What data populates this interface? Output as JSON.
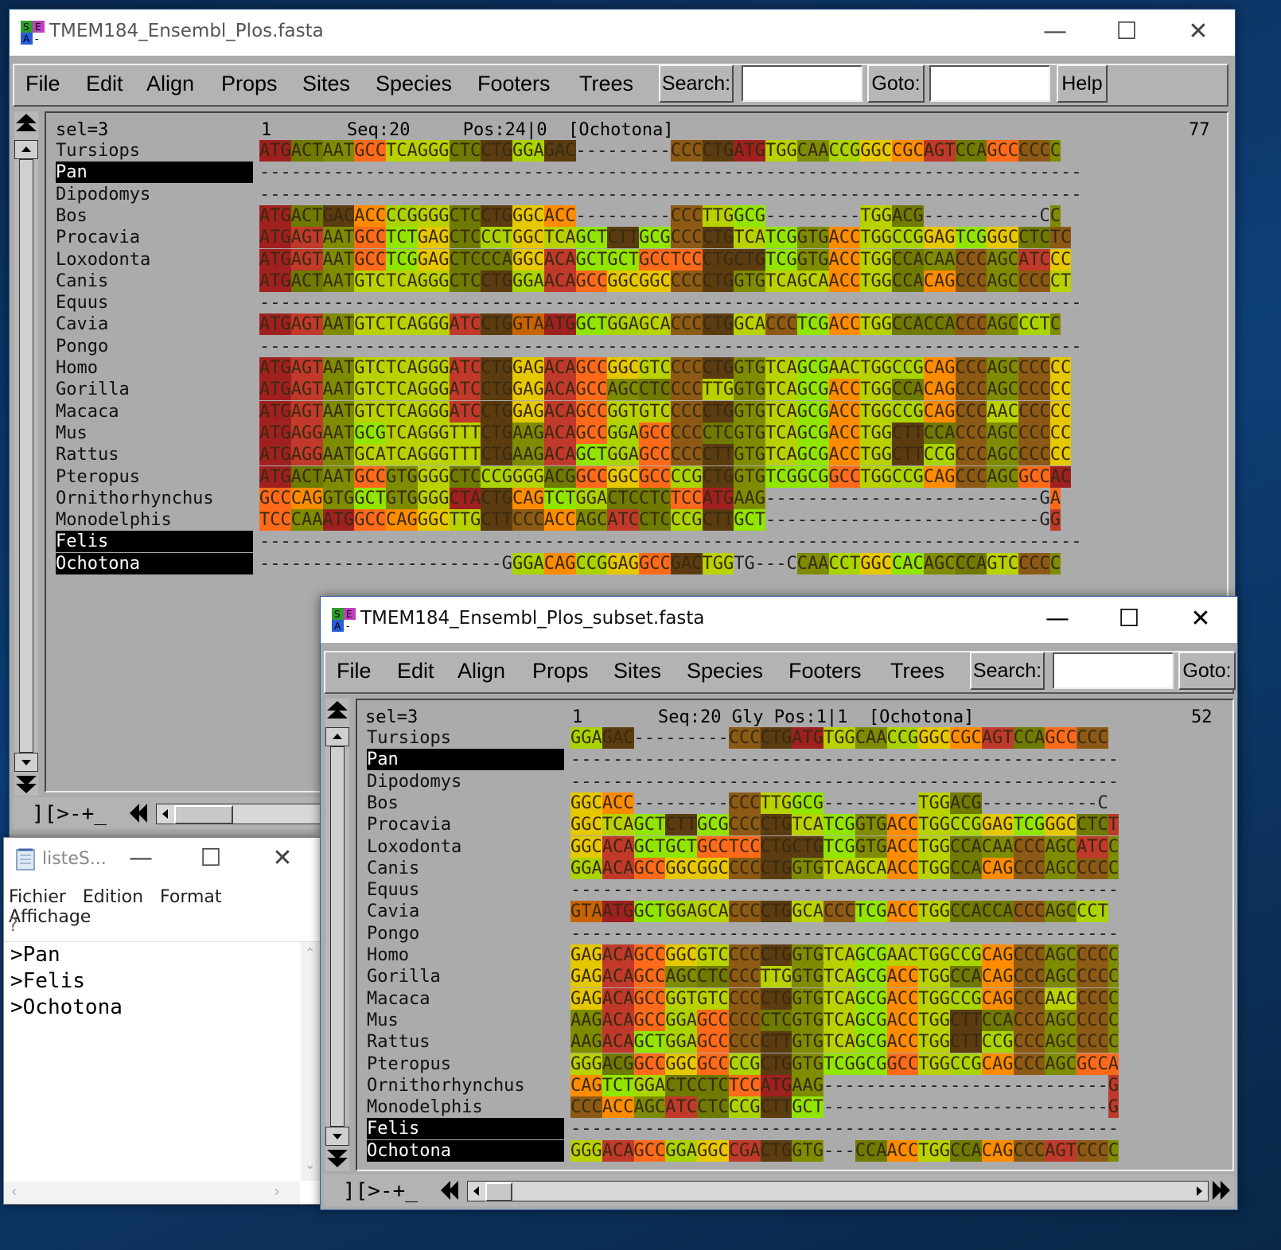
{
  "colors": {
    "A": "#ff6a1a",
    "B": "#8c5a14",
    "C": "#7d8c00",
    "D": "#5a3c10",
    "E": "#91e600",
    "F": "#aad400",
    "G": "#c0392b",
    "H": "#e6c800",
    "I": "#ff8c00",
    "J": "#c86400"
  },
  "main": {
    "title": "TMEM184_Ensembl_Plos.fasta",
    "menu": [
      "File",
      "Edit",
      "Align",
      "Props",
      "Sites",
      "Species",
      "Footers",
      "Trees"
    ],
    "search_label": "Search:",
    "goto_label": "Goto:",
    "help_label": "Help",
    "header": {
      "sel": "sel=3",
      "pos_start": "1",
      "info": "Seq:20     Pos:24|0  [Ochotona]",
      "pos_end": "77"
    },
    "bottom_label": "][>-+_",
    "names": [
      "Tursiops",
      "Pan",
      "Dipodomys",
      "Bos",
      "Procavia",
      "Loxodonta",
      "Canis",
      "Equus",
      "Cavia",
      "Pongo",
      "Homo",
      "Gorilla",
      "Macaca",
      "Mus",
      "Rattus",
      "Pteropus",
      "Ornithorhynchus",
      "Monodelphis",
      "Felis",
      "Ochotona"
    ],
    "selected": [
      1,
      18,
      19
    ],
    "seqs": [
      "ATGACTAATGCCTCAGGGCTCCTGGGAGAC---------CCCCTGATGTGGCAACCGGGCCGCAGTCCAGCCCCCC",
      "------------------------------------------------------------------------------",
      "------------------------------------------------------------------------------",
      "ATGACTGACACCCCGGGGCTCCTGGGCACC---------CCCTTGGCG---------TGGACG-----------CC",
      "ATGAGTAATGCCTCTGAGCTCCCTGGCTCAGCTCTTGCGCCCCTGTCATCGGTGACCTGGCCGGAGTCGGGCCTCTC",
      "ATGAGTAATGCCTCGGAGCTCCCAGGCACAGCTGCTGCCTCCCTGCTGTCGGTGACCTGGCCACAACCCAGCATCCC",
      "ATGACTAATGTCTCAGGGCTCCTGGGAACAGCCGGCGGCCCCCTGGTGTCAGCAACCTGGCCACAGCCCAGCCCCCT",
      "------------------------------------------------------------------------------",
      "ATGAGTAATGTCTCAGGGATCCTGGTAATGGCTGGAGCACCCCTGGCACCCTCGACCTGGCCACCACCCAGCCCTC",
      "------------------------------------------------------------------------------",
      "ATGAGTAATGTCTCAGGGATCCTGGAGACAGCCGGCGTCCCCCTGGTGTCAGCGAACTGGCCGCAGCCCAGCCCCCC",
      "ATGAGTAATGTCTCAGGGATCCTGGAGACAGCCAGCCTCCCCTTGGTGTCAGCGACCTGGCCACAGCCCAGCCCCCC",
      "ATGAGTAATGTCTCAGGGATCCTGGAGACAGCCGGTGTCCCCCTGGTGTCAGCGACCTGGCCGCAGCCCAACCCCCC",
      "ATGAGGAATGCGTCAGGGTTTCTGAAGACAGCCGGAGCCCCCCTCGTGTCAGCGACCTGGCTTCCACCCAGCCCCCC",
      "ATGAGGAATGCATCAGGGTTTCTGAAGACAGCTGGAGCCCCCCTTGTGTCAGCGACCTGGCTTCCGCCCAGCCCCCC",
      "ATGACTAATGCCGTGGGGCTCCCGGGGACGGCCGGCGCCCCGCTGGTGTCGGCGGCCTGGCCGCAGCCCAGCGCCAC",
      "GCCCAGGTGGCTGTGGGGCTACTGCAGTCTGGACTCCTCTCCATGAAG--------------------------GA",
      "TCCCAAATGGCCCAGGGCTTGCTTCCCACCAGCATCCTCCCGCTTGCT--------------------------GG",
      "------------------------------------------------------------------------------",
      "-----------------------GGGACAGCCGGAGGCCGACTGGTG---CCAACCTGGCCACAGCCCAGTCCCCC"
    ]
  },
  "subset": {
    "title": "TMEM184_Ensembl_Plos_subset.fasta",
    "menu": [
      "File",
      "Edit",
      "Align",
      "Props",
      "Sites",
      "Species",
      "Footers",
      "Trees"
    ],
    "search_label": "Search:",
    "goto_label": "Goto:",
    "header": {
      "sel": "sel=3",
      "pos_start": "1",
      "info": "Seq:20 Gly Pos:1|1  [Ochotona]",
      "pos_end": "52"
    },
    "bottom_label": "][>-+_",
    "names": [
      "Tursiops",
      "Pan",
      "Dipodomys",
      "Bos",
      "Procavia",
      "Loxodonta",
      "Canis",
      "Equus",
      "Cavia",
      "Pongo",
      "Homo",
      "Gorilla",
      "Macaca",
      "Mus",
      "Rattus",
      "Pteropus",
      "Ornithorhynchus",
      "Monodelphis",
      "Felis",
      "Ochotona"
    ],
    "selected": [
      1,
      18,
      19
    ],
    "seqs": [
      "GGAGAC---------CCCCTGATGTGGCAACCGGGCCGCAGTCCAGCCCCC",
      "----------------------------------------------------",
      "----------------------------------------------------",
      "GGCACC---------CCCTTGGCG---------TGGACG-----------C",
      "GGCTCAGCTCTTGCGCCCCTGTCATCGGTGACCTGGCCGGAGTCGGGCCTCT",
      "GGCACAGCTGCTGCCTCCCTGCTGTCGGTGACCTGGCCACAACCCAGCATCC",
      "GGAACAGCCGGCGGCCCCCTGGTGTCAGCAACCTGGCCACAGCCCAGCCCCC",
      "----------------------------------------------------",
      "GTAATGGCTGGAGCACCCCTGGCACCCTCGACCTGGCCACCACCCAGCCCT",
      "----------------------------------------------------",
      "GAGACAGCCGGCGTCCCCCTGGTGTCAGCGAACTGGCCGCAGCCCAGCCCCC",
      "GAGACAGCCAGCCTCCCCTTGGTGTCAGCGACCTGGCCACAGCCCAGCCCCC",
      "GAGACAGCCGGTGTCCCCCTGGTGTCAGCGACCTGGCCGCAGCCCAACCCCC",
      "AAGACAGCCGGAGCCCCCCTCGTGTCAGCGACCTGGCTTCCACCCAGCCCCC",
      "AAGACAGCTGGAGCCCCCCTTGTGTCAGCGACCTGGCTTCCGCCCAGCCCCC",
      "GGGACGGCCGGCGCCCCGCTGGTGTCGGCGGCCTGGCCGCAGCCCAGCGCCA",
      "CAGTCTGGACTCCTCTCCATGAAG---------------------------G",
      "CCCACCAGCATCCTCCCGCTTGCT---------------------------G",
      "----------------------------------------------------",
      "GGGACAGCCGGAGGCCGACTGGTG---CCAACCTGGCCACAGCCCAGTCCCC"
    ]
  },
  "notepad": {
    "title": "listeS...",
    "menu": [
      "Fichier",
      "Edition",
      "Format",
      "Affichage"
    ],
    "menu2": "?",
    "lines": [
      ">Pan",
      ">Felis",
      ">Ochotona"
    ]
  }
}
